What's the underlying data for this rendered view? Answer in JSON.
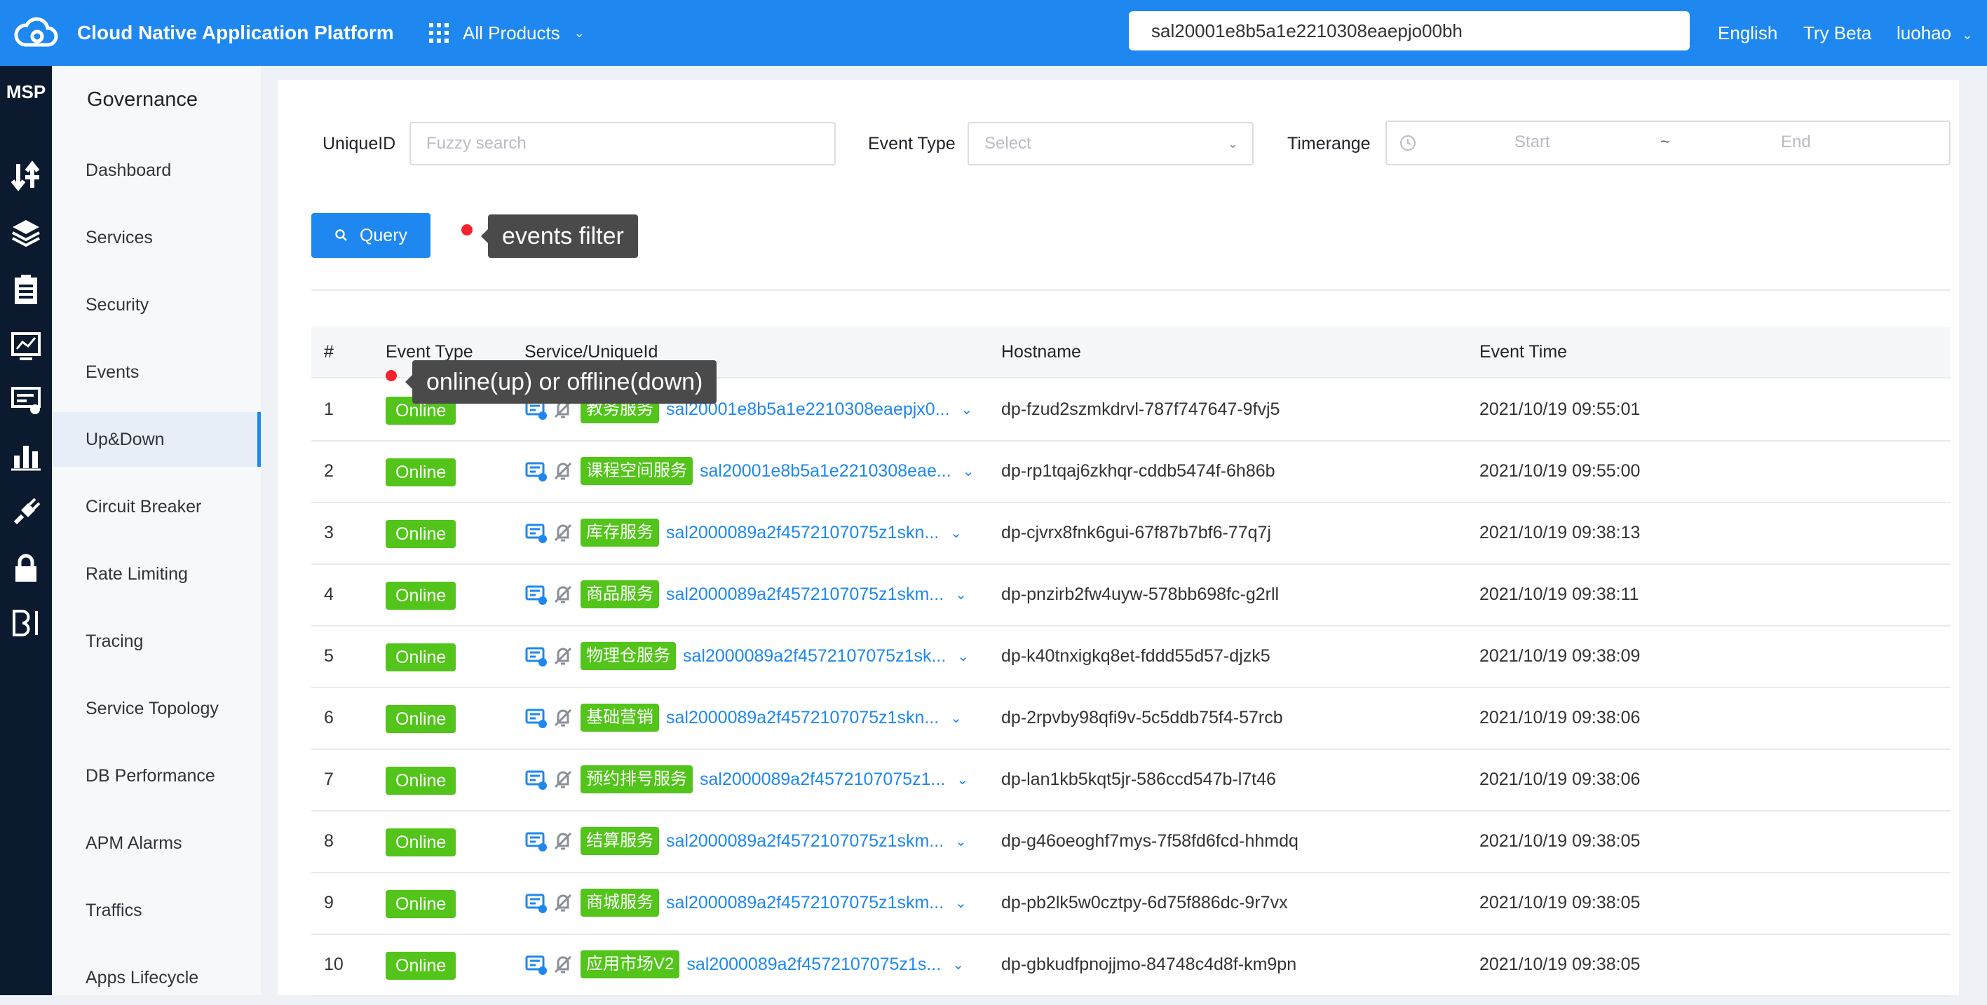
{
  "topbar": {
    "title": "Cloud Native Application Platform",
    "products_label": "All Products",
    "search_value": "sal20001e8b5a1e2210308eaepjo00bh",
    "language": "English",
    "try_beta": "Try Beta",
    "user": "luohao",
    "color": "#1e88f0"
  },
  "rail": {
    "brand": "MSP",
    "icons": [
      "transfer-icon",
      "layers-icon",
      "clipboard-icon",
      "monitor-icon",
      "message-icon",
      "bar-chart-icon",
      "plug-icon",
      "lock-icon",
      "bi-icon"
    ]
  },
  "sidebar": {
    "heading": "Governance",
    "items": [
      {
        "label": "Dashboard"
      },
      {
        "label": "Services"
      },
      {
        "label": "Security"
      },
      {
        "label": "Events"
      },
      {
        "label": "Up&Down"
      },
      {
        "label": "Circuit Breaker"
      },
      {
        "label": "Rate Limiting"
      },
      {
        "label": "Tracing"
      },
      {
        "label": "Service Topology"
      },
      {
        "label": "DB Performance"
      },
      {
        "label": "APM Alarms"
      },
      {
        "label": "Traffics"
      },
      {
        "label": "Apps Lifecycle"
      }
    ],
    "active": "Up&Down"
  },
  "filters": {
    "uniqueid_label": "UniqueID",
    "uniqueid_placeholder": "Fuzzy search",
    "event_type_label": "Event Type",
    "event_type_placeholder": "Select",
    "timerange_label": "Timerange",
    "start_placeholder": "Start",
    "tilde": "~",
    "end_placeholder": "End",
    "query_label": "Query"
  },
  "tooltips": {
    "filter": "events filter",
    "event_type": "online(up) or offline(down)"
  },
  "table": {
    "headers": {
      "index": "#",
      "event_type": "Event Type",
      "service": "Service/UniqueId",
      "hostname": "Hostname",
      "event_time": "Event Time"
    },
    "rows": [
      {
        "index": "1",
        "event": "Online",
        "service": "教务服务",
        "unique_id": "sal20001e8b5a1e2210308eaepjx0...",
        "hostname": "dp-fzud2szmkdrvl-787f747647-9fvj5",
        "time": "2021/10/19 09:55:01"
      },
      {
        "index": "2",
        "event": "Online",
        "service": "课程空间服务",
        "unique_id": "sal20001e8b5a1e2210308eae...",
        "hostname": "dp-rp1tqaj6zkhqr-cddb5474f-6h86b",
        "time": "2021/10/19 09:55:00"
      },
      {
        "index": "3",
        "event": "Online",
        "service": "库存服务",
        "unique_id": "sal2000089a2f4572107075z1skn...",
        "hostname": "dp-cjvrx8fnk6gui-67f87b7bf6-77q7j",
        "time": "2021/10/19 09:38:13"
      },
      {
        "index": "4",
        "event": "Online",
        "service": "商品服务",
        "unique_id": "sal2000089a2f4572107075z1skm...",
        "hostname": "dp-pnzirb2fw4uyw-578bb698fc-g2rll",
        "time": "2021/10/19 09:38:11"
      },
      {
        "index": "5",
        "event": "Online",
        "service": "物理仓服务",
        "unique_id": "sal2000089a2f4572107075z1sk...",
        "hostname": "dp-k40tnxigkq8et-fddd55d57-djzk5",
        "time": "2021/10/19 09:38:09"
      },
      {
        "index": "6",
        "event": "Online",
        "service": "基础营销",
        "unique_id": "sal2000089a2f4572107075z1skn...",
        "hostname": "dp-2rpvby98qfi9v-5c5ddb75f4-57rcb",
        "time": "2021/10/19 09:38:06"
      },
      {
        "index": "7",
        "event": "Online",
        "service": "预约排号服务",
        "unique_id": "sal2000089a2f4572107075z1...",
        "hostname": "dp-lan1kb5kqt5jr-586ccd547b-l7t46",
        "time": "2021/10/19 09:38:06"
      },
      {
        "index": "8",
        "event": "Online",
        "service": "结算服务",
        "unique_id": "sal2000089a2f4572107075z1skm...",
        "hostname": "dp-g46oeoghf7mys-7f58fd6fcd-hhmdq",
        "time": "2021/10/19 09:38:05"
      },
      {
        "index": "9",
        "event": "Online",
        "service": "商城服务",
        "unique_id": "sal2000089a2f4572107075z1skm...",
        "hostname": "dp-pb2lk5w0cztpy-6d75f886dc-9r7vx",
        "time": "2021/10/19 09:38:05"
      },
      {
        "index": "10",
        "event": "Online",
        "service": "应用市场V2",
        "unique_id": "sal2000089a2f4572107075z1s...",
        "hostname": "dp-gbkudfpnojjmo-84748c4d8f-km9pn",
        "time": "2021/10/19 09:38:05"
      }
    ]
  }
}
